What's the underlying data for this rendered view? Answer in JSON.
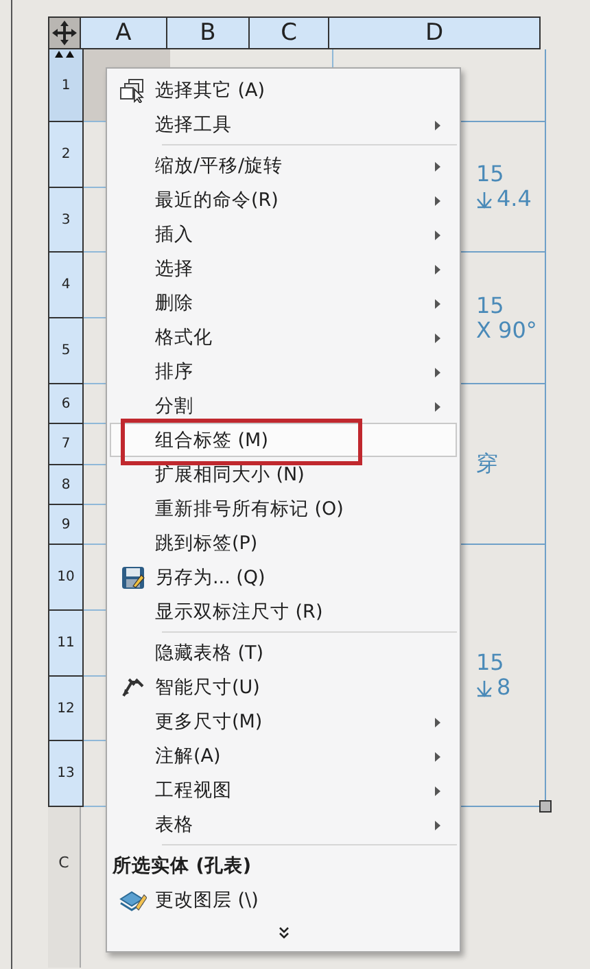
{
  "table": {
    "columns": [
      "A",
      "B",
      "C",
      "D"
    ],
    "rows": [
      {
        "label": "1",
        "selected": true
      },
      {
        "label": "2",
        "selected": false
      },
      {
        "label": "3",
        "selected": false
      },
      {
        "label": "4",
        "selected": false
      },
      {
        "label": "5",
        "selected": false
      },
      {
        "label": "6",
        "selected": false
      },
      {
        "label": "7",
        "selected": false
      },
      {
        "label": "8",
        "selected": false
      },
      {
        "label": "9",
        "selected": false
      },
      {
        "label": "10",
        "selected": false
      },
      {
        "label": "11",
        "selected": false
      },
      {
        "label": "12",
        "selected": false
      },
      {
        "label": "13",
        "selected": false
      }
    ],
    "d_cells": [
      {},
      {
        "lines": [
          {
            "kind": "plain",
            "text": "15"
          },
          {
            "kind": "depth",
            "text": "4.4"
          }
        ]
      },
      {
        "lines": [
          {
            "kind": "plain",
            "text": "15"
          },
          {
            "kind": "plain",
            "text": "X 90°"
          }
        ]
      },
      {
        "lines": [
          {
            "kind": "plain",
            "text": "穿"
          }
        ]
      },
      {
        "lines": [
          {
            "kind": "plain",
            "text": "15"
          },
          {
            "kind": "depth",
            "text": "8"
          }
        ]
      }
    ]
  },
  "section_label": "C",
  "menu": {
    "items": [
      {
        "kind": "item",
        "label": "选择其它 (A)",
        "submenu": false,
        "selected": false
      },
      {
        "kind": "item",
        "label": "选择工具",
        "submenu": true,
        "selected": false
      },
      {
        "kind": "separator"
      },
      {
        "kind": "item",
        "label": "缩放/平移/旋转",
        "submenu": true,
        "selected": false
      },
      {
        "kind": "item",
        "label": "最近的命令(R)",
        "submenu": true,
        "selected": false
      },
      {
        "kind": "item",
        "label": "插入",
        "submenu": true,
        "selected": false
      },
      {
        "kind": "item",
        "label": "选择",
        "submenu": true,
        "selected": false
      },
      {
        "kind": "item",
        "label": "删除",
        "submenu": true,
        "selected": false
      },
      {
        "kind": "item",
        "label": "格式化",
        "submenu": true,
        "selected": false
      },
      {
        "kind": "item",
        "label": "排序",
        "submenu": true,
        "selected": false
      },
      {
        "kind": "item",
        "label": "分割",
        "submenu": true,
        "selected": false
      },
      {
        "kind": "item",
        "label": "组合标签 (M)",
        "submenu": false,
        "selected": true
      },
      {
        "kind": "item",
        "label": "扩展相同大小 (N)",
        "submenu": false,
        "selected": false
      },
      {
        "kind": "item",
        "label": "重新排号所有标记 (O)",
        "submenu": false,
        "selected": false
      },
      {
        "kind": "item",
        "label": "跳到标签(P)",
        "submenu": false,
        "selected": false
      },
      {
        "kind": "item",
        "label": "另存为... (Q)",
        "submenu": false,
        "selected": false
      },
      {
        "kind": "item",
        "label": "显示双标注尺寸 (R)",
        "submenu": false,
        "selected": false
      },
      {
        "kind": "separator"
      },
      {
        "kind": "item",
        "label": "隐藏表格 (T)",
        "submenu": false,
        "selected": false
      },
      {
        "kind": "item",
        "label": "智能尺寸(U)",
        "submenu": false,
        "selected": false
      },
      {
        "kind": "item",
        "label": "更多尺寸(M)",
        "submenu": true,
        "selected": false
      },
      {
        "kind": "item",
        "label": "注解(A)",
        "submenu": true,
        "selected": false
      },
      {
        "kind": "item",
        "label": "工程视图",
        "submenu": true,
        "selected": false
      },
      {
        "kind": "item",
        "label": "表格",
        "submenu": true,
        "selected": false
      },
      {
        "kind": "separator"
      },
      {
        "kind": "header",
        "label": "所选实体 (孔表)"
      },
      {
        "kind": "item",
        "label": "更改图层 (\\)",
        "submenu": false,
        "selected": false
      },
      {
        "kind": "more"
      }
    ]
  }
}
